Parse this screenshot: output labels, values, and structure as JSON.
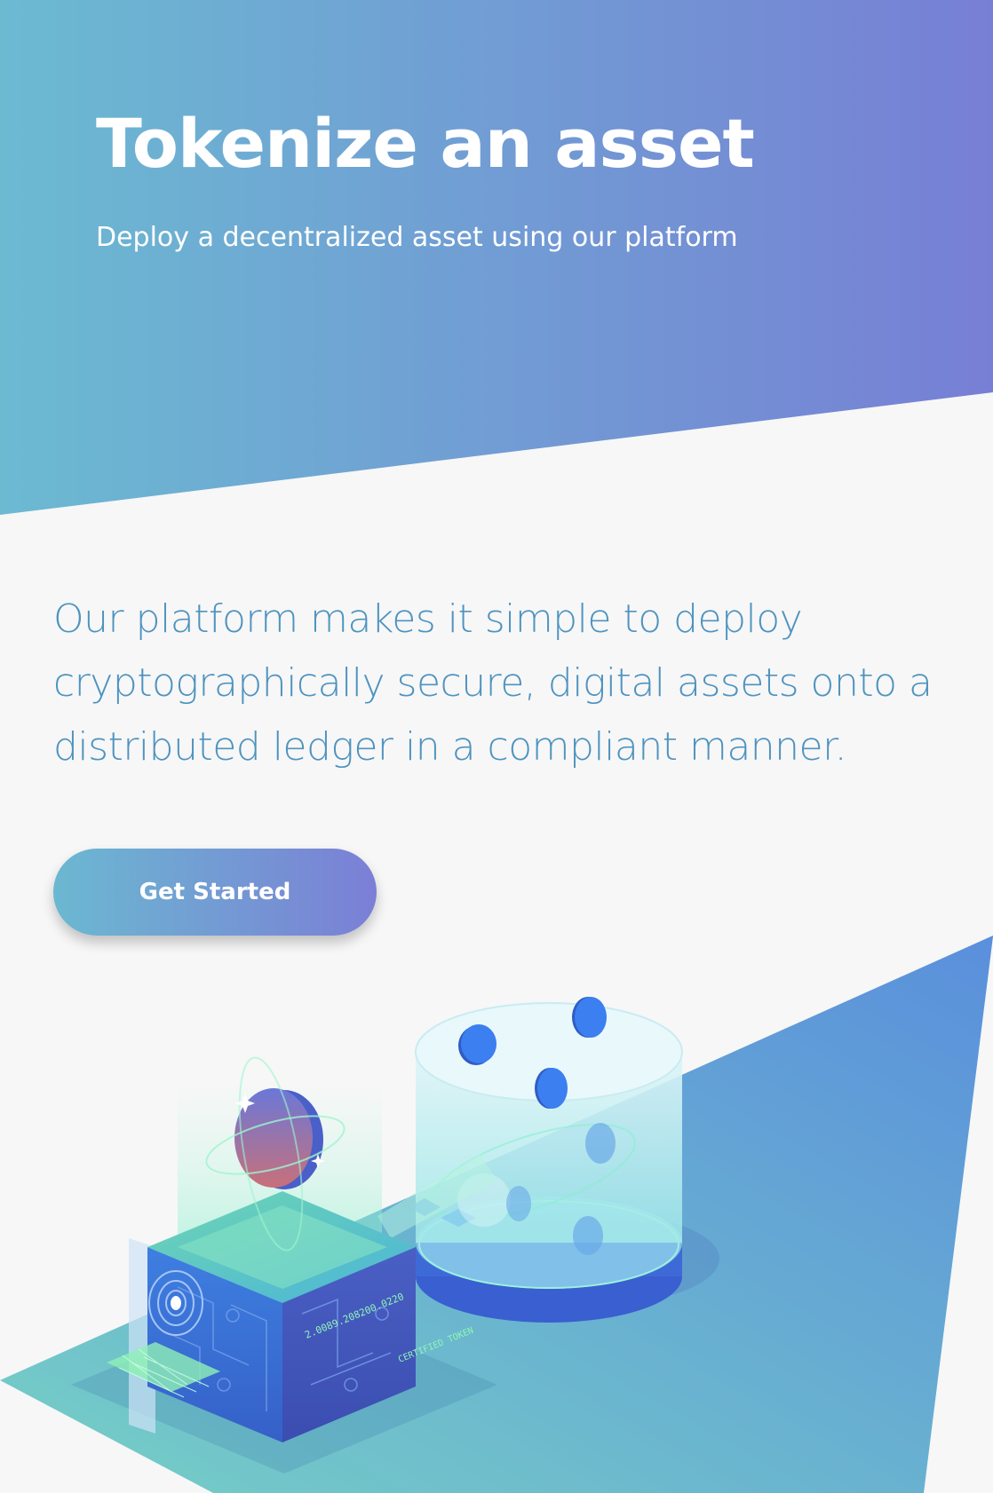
{
  "hero": {
    "title": "Tokenize an asset",
    "subtitle": "Deploy a decentralized asset using our platform"
  },
  "main": {
    "description": "Our platform makes it simple to deploy cryptographically secure, digital assets onto a distributed ledger in a compliant manner.",
    "cta_label": "Get Started"
  },
  "illustration": {
    "cube_label": "2.0089.208200.0220",
    "token_label": "CERTIFIED TOKEN"
  },
  "colors": {
    "gradient_start": "#6bb8d1",
    "gradient_end": "#7b7fd6",
    "body_text": "#4e93bf",
    "page_background": "#f7f7f7"
  }
}
